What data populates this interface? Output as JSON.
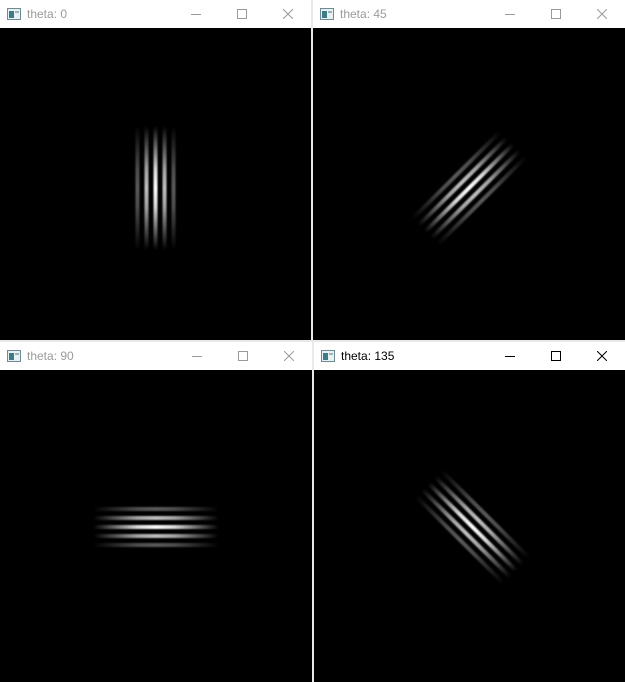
{
  "windows": [
    {
      "title": "theta: 0",
      "theta": 0,
      "active": false
    },
    {
      "title": "theta: 45",
      "theta": 45,
      "active": false
    },
    {
      "title": "theta: 90",
      "theta": 90,
      "active": false
    },
    {
      "title": "theta: 135",
      "theta": 135,
      "active": true
    }
  ],
  "icons": {
    "minimize": "minimize-icon",
    "maximize": "maximize-icon",
    "close": "close-icon"
  },
  "colors": {
    "titlebar": "#ffffff",
    "inactive_text": "#9a9a9a",
    "active_text": "#000000",
    "canvas": "#000000",
    "stripe": "#ffffff"
  }
}
